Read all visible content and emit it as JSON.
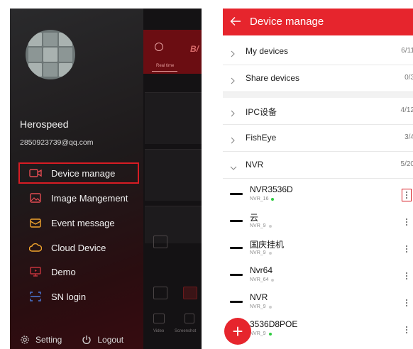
{
  "drawer": {
    "username": "Herospeed",
    "email": "2850923739@qq.com",
    "menu": [
      {
        "label": "Device manage",
        "icon": "camera-icon",
        "active": true
      },
      {
        "label": "Image Mangement",
        "icon": "image-icon",
        "active": false
      },
      {
        "label": "Event message",
        "icon": "envelope-icon",
        "active": false
      },
      {
        "label": "Cloud Device",
        "icon": "cloud-icon",
        "active": false
      },
      {
        "label": "Demo",
        "icon": "monitor-icon",
        "active": false
      },
      {
        "label": "SN login",
        "icon": "scan-icon",
        "active": false
      }
    ],
    "setting_label": "Setting",
    "logout_label": "Logout"
  },
  "background_app": {
    "brand_fragment": "B/",
    "tab_label": "Real time",
    "video_label": "Video",
    "screenshot_label": "Screenshot"
  },
  "device_manage": {
    "title": "Device manage",
    "groups": [
      {
        "label": "My devices",
        "count": "6/11",
        "expanded": false
      },
      {
        "label": "Share devices",
        "count": "0/3",
        "expanded": false
      },
      {
        "label": "IPC设备",
        "count": "4/12",
        "expanded": false
      },
      {
        "label": "FishEye",
        "count": "3/4",
        "expanded": false
      },
      {
        "label": "NVR",
        "count": "5/20",
        "expanded": true
      }
    ],
    "devices": [
      {
        "name": "NVR3536D",
        "sub": "NVR_16",
        "online": true
      },
      {
        "name": "云",
        "sub": "NVR_9",
        "online": false
      },
      {
        "name": "国庆挂机",
        "sub": "NVR_9",
        "online": false
      },
      {
        "name": "Nvr64",
        "sub": "NVR_64",
        "online": false
      },
      {
        "name": "NVR",
        "sub": "NVR_9",
        "online": false
      },
      {
        "name": "3536D8POE",
        "sub": "NVR_9",
        "online": true
      }
    ],
    "colors": {
      "accent": "#e6252d",
      "online": "#2ecc40",
      "offline": "#cfcfcf",
      "highlight": "#d71c24"
    }
  }
}
